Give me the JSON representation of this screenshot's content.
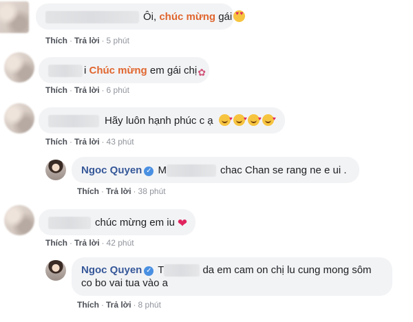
{
  "actions": {
    "like": "Thích",
    "reply": "Trả lời",
    "separator": "·"
  },
  "comments": [
    {
      "prefix": "Ôi, ",
      "highlight": "chúc mừng",
      "suffix": " gái",
      "emoji": "heart-eyes",
      "time": "5 phút"
    },
    {
      "prefix": "i ",
      "highlight": "Chúc mừng",
      "suffix": " em gái chị",
      "emoji": "bouquet",
      "time": "6 phút"
    },
    {
      "text": "Hãy luôn hạnh phúc c ạ",
      "emoji_count": 4,
      "time": "43 phút"
    },
    {
      "author": "Ngoc Quyen",
      "prefix": "M",
      "text": "chac Chan se rang ne e ui .",
      "time": "38 phút",
      "verified": true
    },
    {
      "text": "chúc mừng em iu",
      "emoji": "red-heart",
      "time": "42 phút"
    },
    {
      "author": "Ngoc Quyen",
      "prefix": "T",
      "text_line1": "da em cam on chị lu cung mong sôm",
      "text_line2": "co bo vai tua vào a",
      "time": "8 phút",
      "verified": true
    }
  ],
  "colors": {
    "bubble": "#f2f3f5",
    "name": "#365899",
    "highlight": "#e0662e",
    "meta": "#90949c",
    "heart": "#e0245e"
  }
}
